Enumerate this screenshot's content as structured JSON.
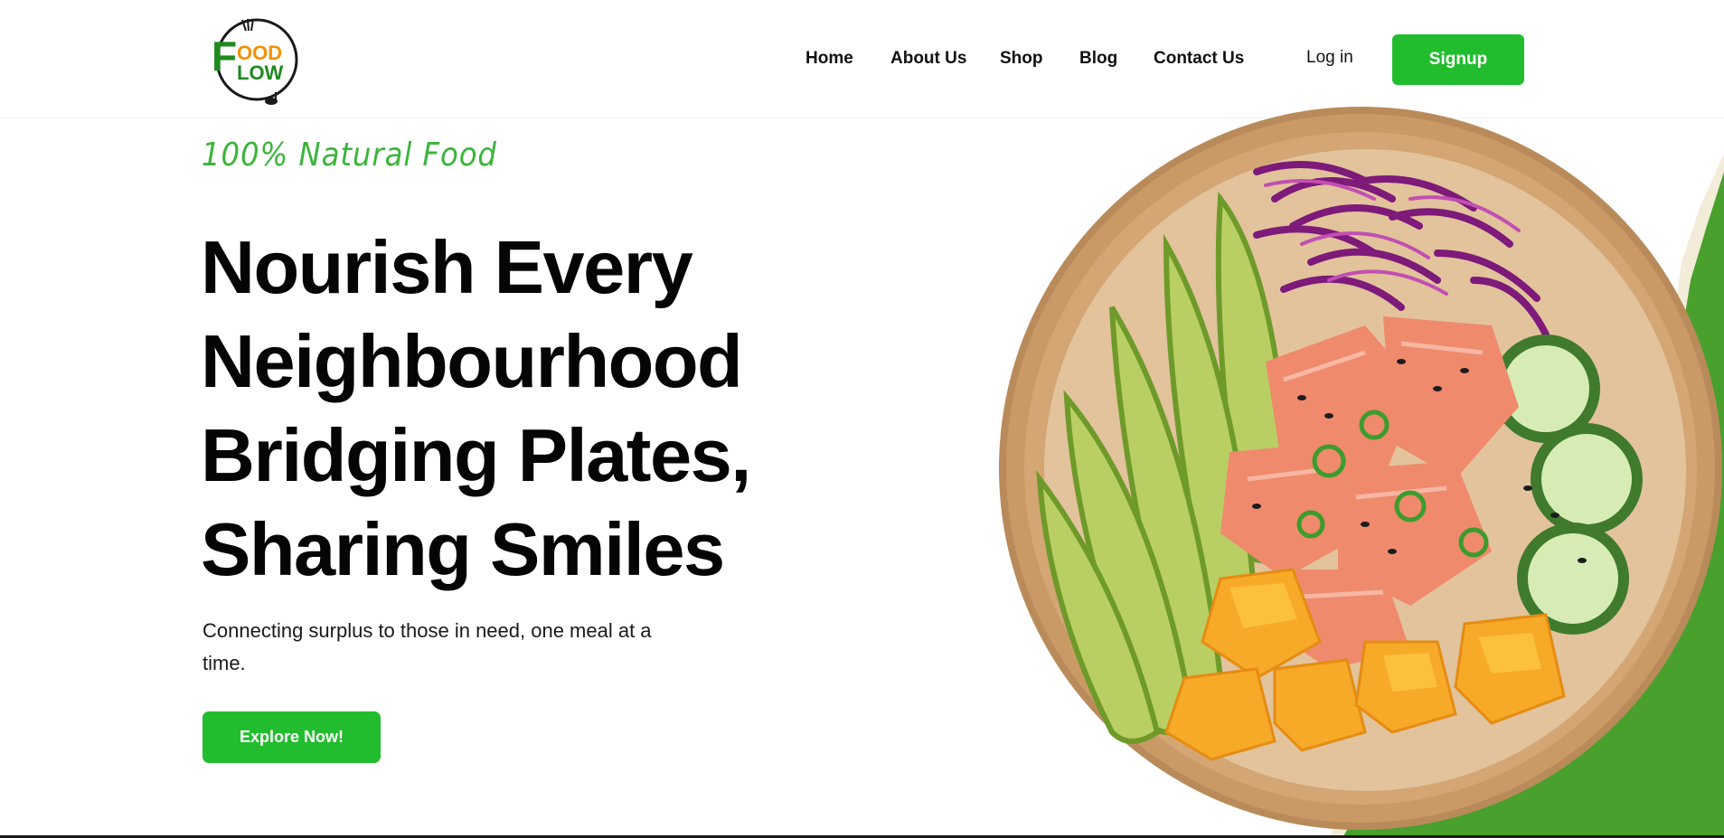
{
  "brand": {
    "logo_text_line1": "OOD",
    "logo_text_line2": "LOW",
    "logo_initial": "F",
    "colors": {
      "primary_green": "#22bd2e",
      "logo_green": "#1f8a1f",
      "logo_orange": "#f39200",
      "wave_green": "#49a02c"
    }
  },
  "nav": {
    "items": [
      {
        "label": "Home"
      },
      {
        "label": "About Us"
      },
      {
        "label": "Shop"
      },
      {
        "label": "Blog"
      },
      {
        "label": "Contact Us"
      }
    ],
    "login_label": "Log in",
    "signup_label": "Signup"
  },
  "hero": {
    "tagline": "100% Natural Food",
    "headline": [
      "Nourish Every",
      "Neighbourhood",
      "Bridging Plates,",
      "Sharing Smiles"
    ],
    "subtitle": "Connecting surplus to those in need, one meal at a time.",
    "cta_label": "Explore Now!"
  }
}
